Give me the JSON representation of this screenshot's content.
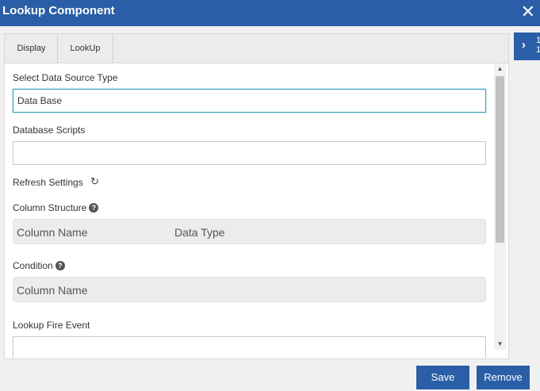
{
  "dialog": {
    "title": "Lookup Component",
    "close_glyph": "✕"
  },
  "side_tab": {
    "glyph": "›",
    "fragment": "1\n1"
  },
  "tabs": [
    {
      "label": "Display"
    },
    {
      "label": "LookUp"
    }
  ],
  "form": {
    "data_source_label": "Select Data Source Type",
    "data_source_value": "Data Base",
    "db_scripts_label": "Database Scripts",
    "db_scripts_value": "",
    "refresh_label": "Refresh Settings",
    "column_structure_label": "Column Structure",
    "column_structure_headers": [
      "Column Name",
      "Data Type"
    ],
    "condition_label": "Condition",
    "condition_headers": [
      "Column Name"
    ],
    "fire_event_label": "Lookup Fire Event",
    "fire_event_value": ""
  },
  "buttons": {
    "save": "Save",
    "remove": "Remove"
  },
  "colors": {
    "accent": "#2a5ea6",
    "focus_border": "#3aa0b6"
  }
}
